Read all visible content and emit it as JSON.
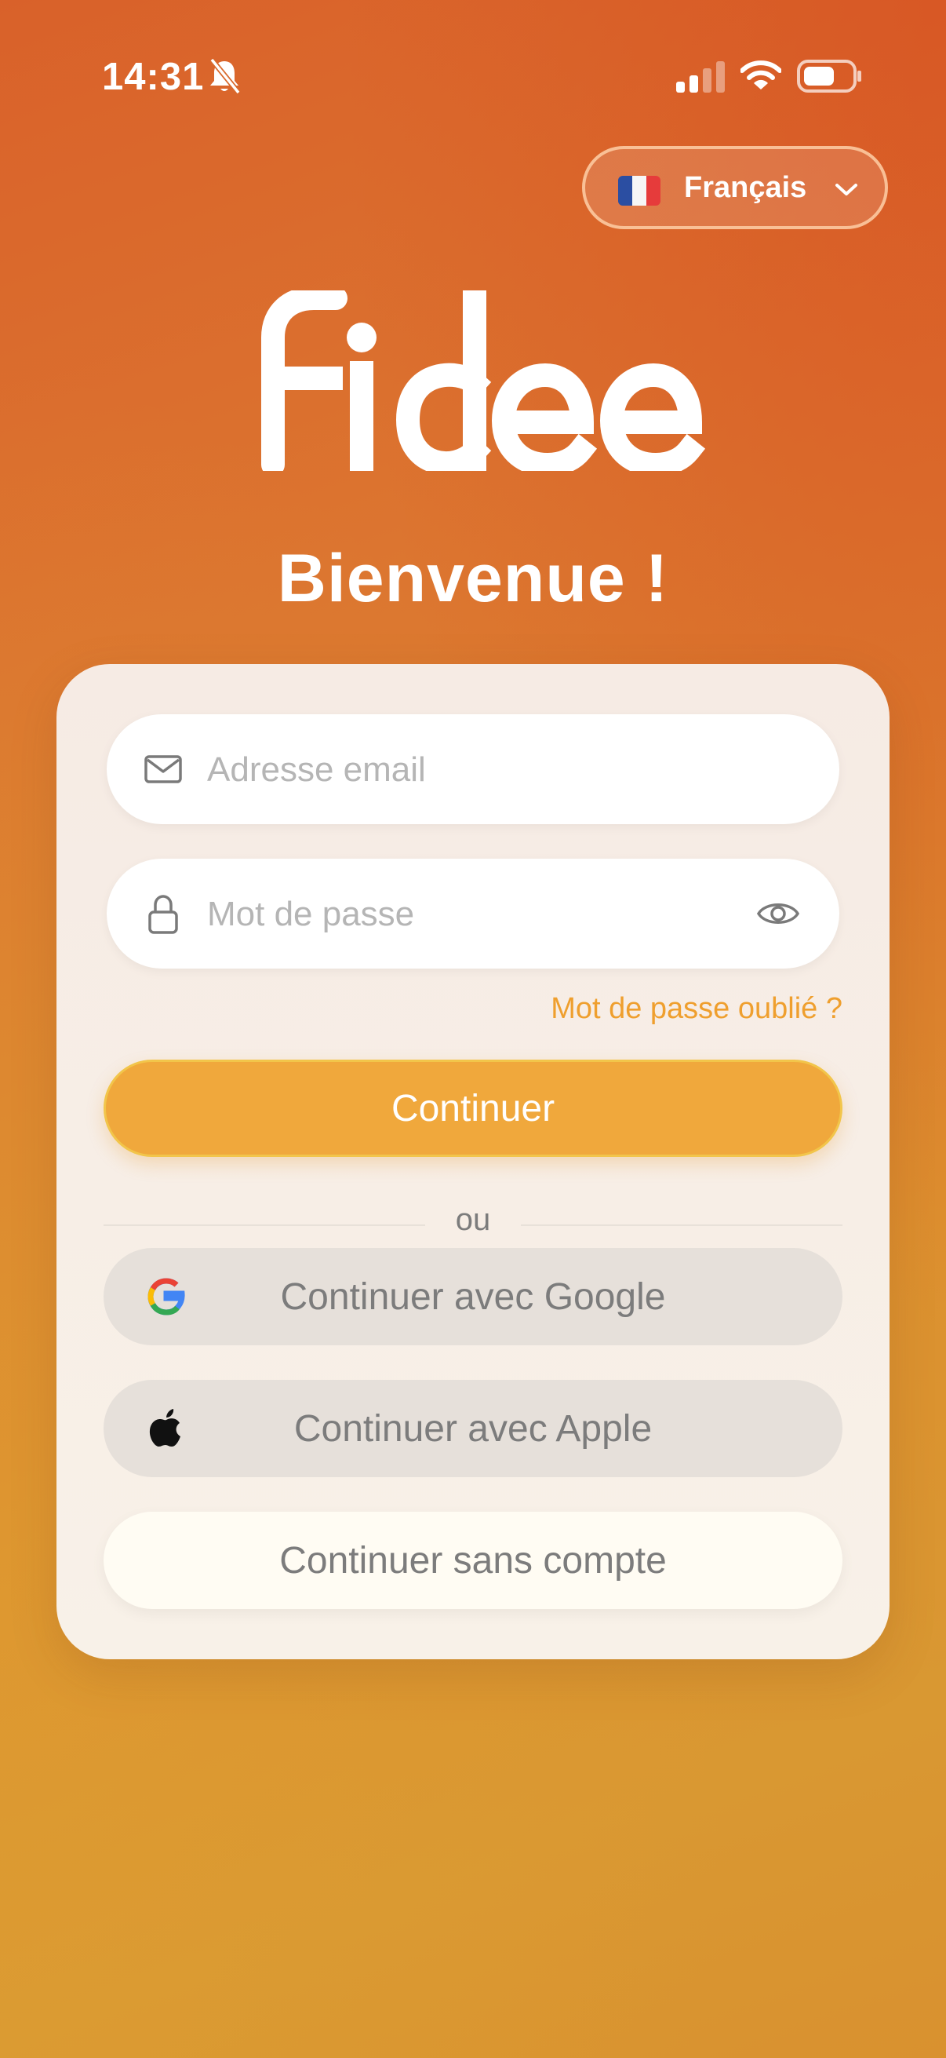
{
  "status_bar": {
    "time": "14:31"
  },
  "language": {
    "flag": "🇫🇷",
    "label": "Français"
  },
  "brand": {
    "logo_text": "fidee"
  },
  "welcome": "Bienvenue !",
  "form": {
    "email_placeholder": "Adresse email",
    "password_placeholder": "Mot de passe",
    "forgot_password": "Mot de passe oublié ?",
    "continue": "Continuer",
    "or": "ou",
    "google": "Continuer avec Google",
    "apple": "Continuer avec Apple",
    "guest": "Continuer sans compte"
  },
  "colors": {
    "accent": "#f0a83c",
    "link": "#ef9f2e"
  }
}
